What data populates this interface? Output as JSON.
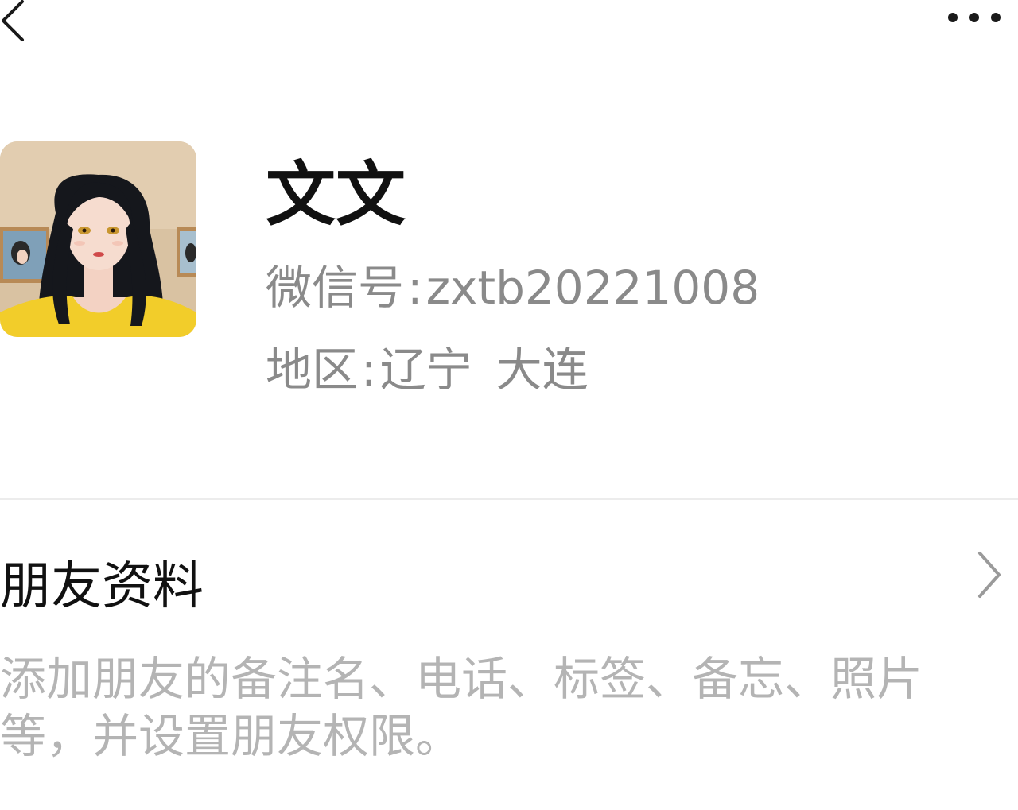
{
  "profile": {
    "nickname": "文文",
    "wechat_id_label": "微信号",
    "wechat_id_value": "zxtb20221008",
    "region_label": "地区",
    "region_province": "辽宁",
    "region_city": "大连",
    "separator": ":"
  },
  "friend_info": {
    "title": "朋友资料",
    "description": "添加朋友的备注名、电话、标签、备忘、照片等，并设置朋友权限。"
  },
  "icons": {
    "back": "chevron-left-icon",
    "more": "more-dots-icon",
    "row_arrow": "chevron-right-icon"
  },
  "colors": {
    "title_text": "#111111",
    "secondary_text": "#8a8a8a",
    "hint_text": "#b4b4b4",
    "divider": "#ececec"
  }
}
